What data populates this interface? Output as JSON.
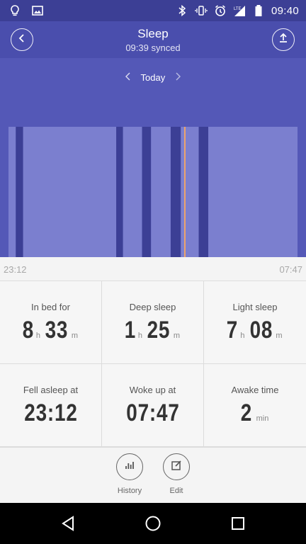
{
  "status_bar": {
    "time": "09:40",
    "left_icons": [
      "lightbulb-icon",
      "image-icon"
    ],
    "right_icons": [
      "bluetooth-icon",
      "vibrate-icon",
      "alarm-icon",
      "lte-signal-icon",
      "battery-icon"
    ],
    "network": "LTE"
  },
  "header": {
    "title": "Sleep",
    "subtitle": "09:39 synced",
    "back_icon": "chevron-left-icon",
    "share_icon": "upload-icon"
  },
  "date_nav": {
    "label": "Today",
    "prev_icon": "chevron-left-icon",
    "next_icon": "chevron-right-icon"
  },
  "chart_data": {
    "type": "timeline",
    "start": "23:12",
    "end": "07:47",
    "segments": [
      {
        "stage": "light",
        "from": "23:12",
        "to": "23:25"
      },
      {
        "stage": "deep",
        "from": "23:25",
        "to": "23:38"
      },
      {
        "stage": "light",
        "from": "23:38",
        "to": "02:24"
      },
      {
        "stage": "deep",
        "from": "02:24",
        "to": "02:36"
      },
      {
        "stage": "light",
        "from": "02:36",
        "to": "03:10"
      },
      {
        "stage": "deep",
        "from": "03:10",
        "to": "03:26"
      },
      {
        "stage": "light",
        "from": "03:26",
        "to": "04:01"
      },
      {
        "stage": "deep",
        "from": "04:01",
        "to": "04:19"
      },
      {
        "stage": "light",
        "from": "04:19",
        "to": "04:51"
      },
      {
        "stage": "deep",
        "from": "04:51",
        "to": "05:08"
      },
      {
        "stage": "light",
        "from": "05:08",
        "to": "07:47"
      }
    ],
    "awake_marker": "04:25",
    "colors": {
      "background": "#5458b7",
      "light": "#7b7fcf",
      "deep": "#3c3f95",
      "awake": "#f0a46a"
    }
  },
  "timeline": {
    "start_label": "23:12",
    "end_label": "07:47"
  },
  "stats": {
    "in_bed": {
      "label": "In bed for",
      "h": "8",
      "h_unit": "h",
      "m": "33",
      "m_unit": "m"
    },
    "deep": {
      "label": "Deep sleep",
      "h": "1",
      "h_unit": "h",
      "m": "25",
      "m_unit": "m"
    },
    "light": {
      "label": "Light sleep",
      "h": "7",
      "h_unit": "h",
      "m": "08",
      "m_unit": "m"
    },
    "fell_asleep": {
      "label": "Fell asleep at",
      "value": "23:12"
    },
    "woke_up": {
      "label": "Woke up at",
      "value": "07:47"
    },
    "awake": {
      "label": "Awake time",
      "value": "2",
      "unit": "min"
    }
  },
  "actions": {
    "history": {
      "label": "History",
      "icon": "bar-chart-icon"
    },
    "edit": {
      "label": "Edit",
      "icon": "edit-icon"
    }
  },
  "nav_bar": {
    "icons": [
      "back-triangle-icon",
      "home-circle-icon",
      "recents-square-icon"
    ]
  }
}
